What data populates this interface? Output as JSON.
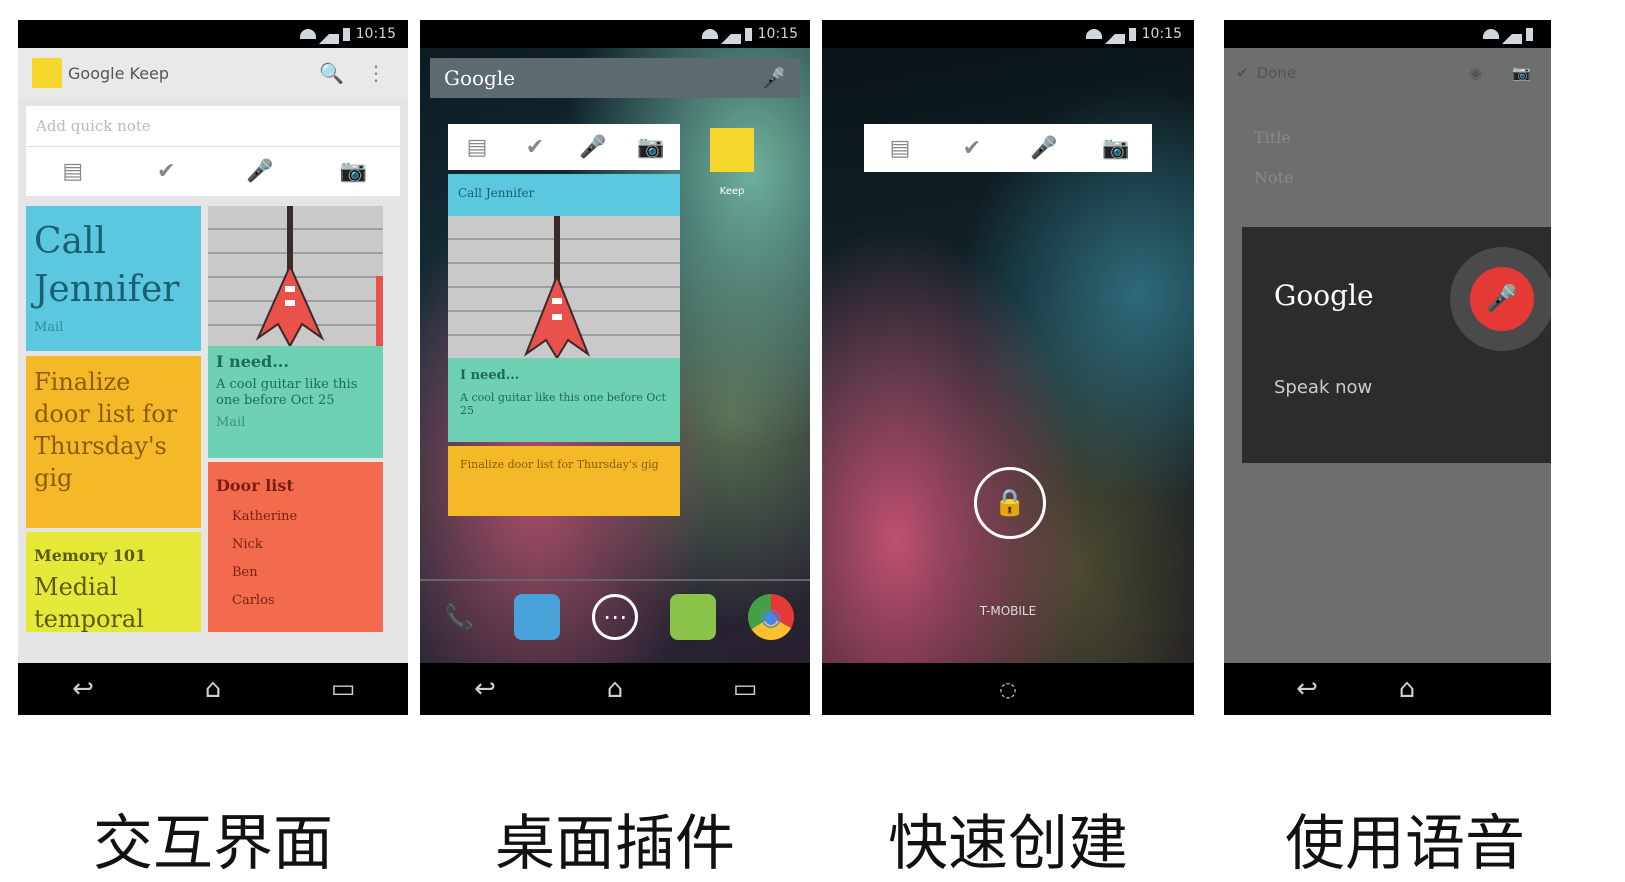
{
  "status_time": "10:15",
  "screens": [
    {
      "app_title": "Google Keep",
      "quick_note_placeholder": "Add quick note",
      "cards": {
        "call": "Call Jennifer",
        "call_meta": "Mail",
        "need_title": "I need...",
        "need_body": "A cool guitar like this one before Oct 25",
        "need_meta": "Mail",
        "finalize": "Finalize door list for Thursday's gig",
        "door_title": "Door list",
        "door_items": [
          "Katherine",
          "Nick",
          "Ben",
          "Carlos"
        ],
        "memory_title": "Memory 101",
        "memory_body": "Medial temporal"
      },
      "caption": "交互界面"
    },
    {
      "search_label": "Google",
      "widget": {
        "call": "Call Jennifer",
        "need_title": "I need...",
        "need_body": "A cool guitar like this one before Oct 25",
        "finalize": "Finalize door list for Thursday's gig"
      },
      "app_label": "Keep",
      "caption": "桌面插件"
    },
    {
      "carrier": "T-MOBILE",
      "caption": "快速创建"
    },
    {
      "done_label": "Done",
      "title_placeholder": "Title",
      "note_placeholder": "Note",
      "voice_brand": "Google",
      "speak_now": "Speak now",
      "caption": "使用语音"
    }
  ],
  "icons": {
    "note": "▤",
    "check": "✔",
    "mic": "🎤",
    "camera": "📷",
    "search": "🔍",
    "menu": "⋮",
    "back": "↩",
    "home": "⌂",
    "recent": "▭",
    "lock": "🔒",
    "phone": "📞",
    "apps": "⋯",
    "chrome": "◉"
  },
  "colors": {
    "keep_yellow": "#f6d72b",
    "card_blue": "#5bc8e0",
    "card_orange": "#f5b829",
    "card_teal": "#6fd1b3",
    "card_red": "#f36b4e",
    "card_lime": "#e6e83a",
    "mic_red": "#e53935"
  }
}
